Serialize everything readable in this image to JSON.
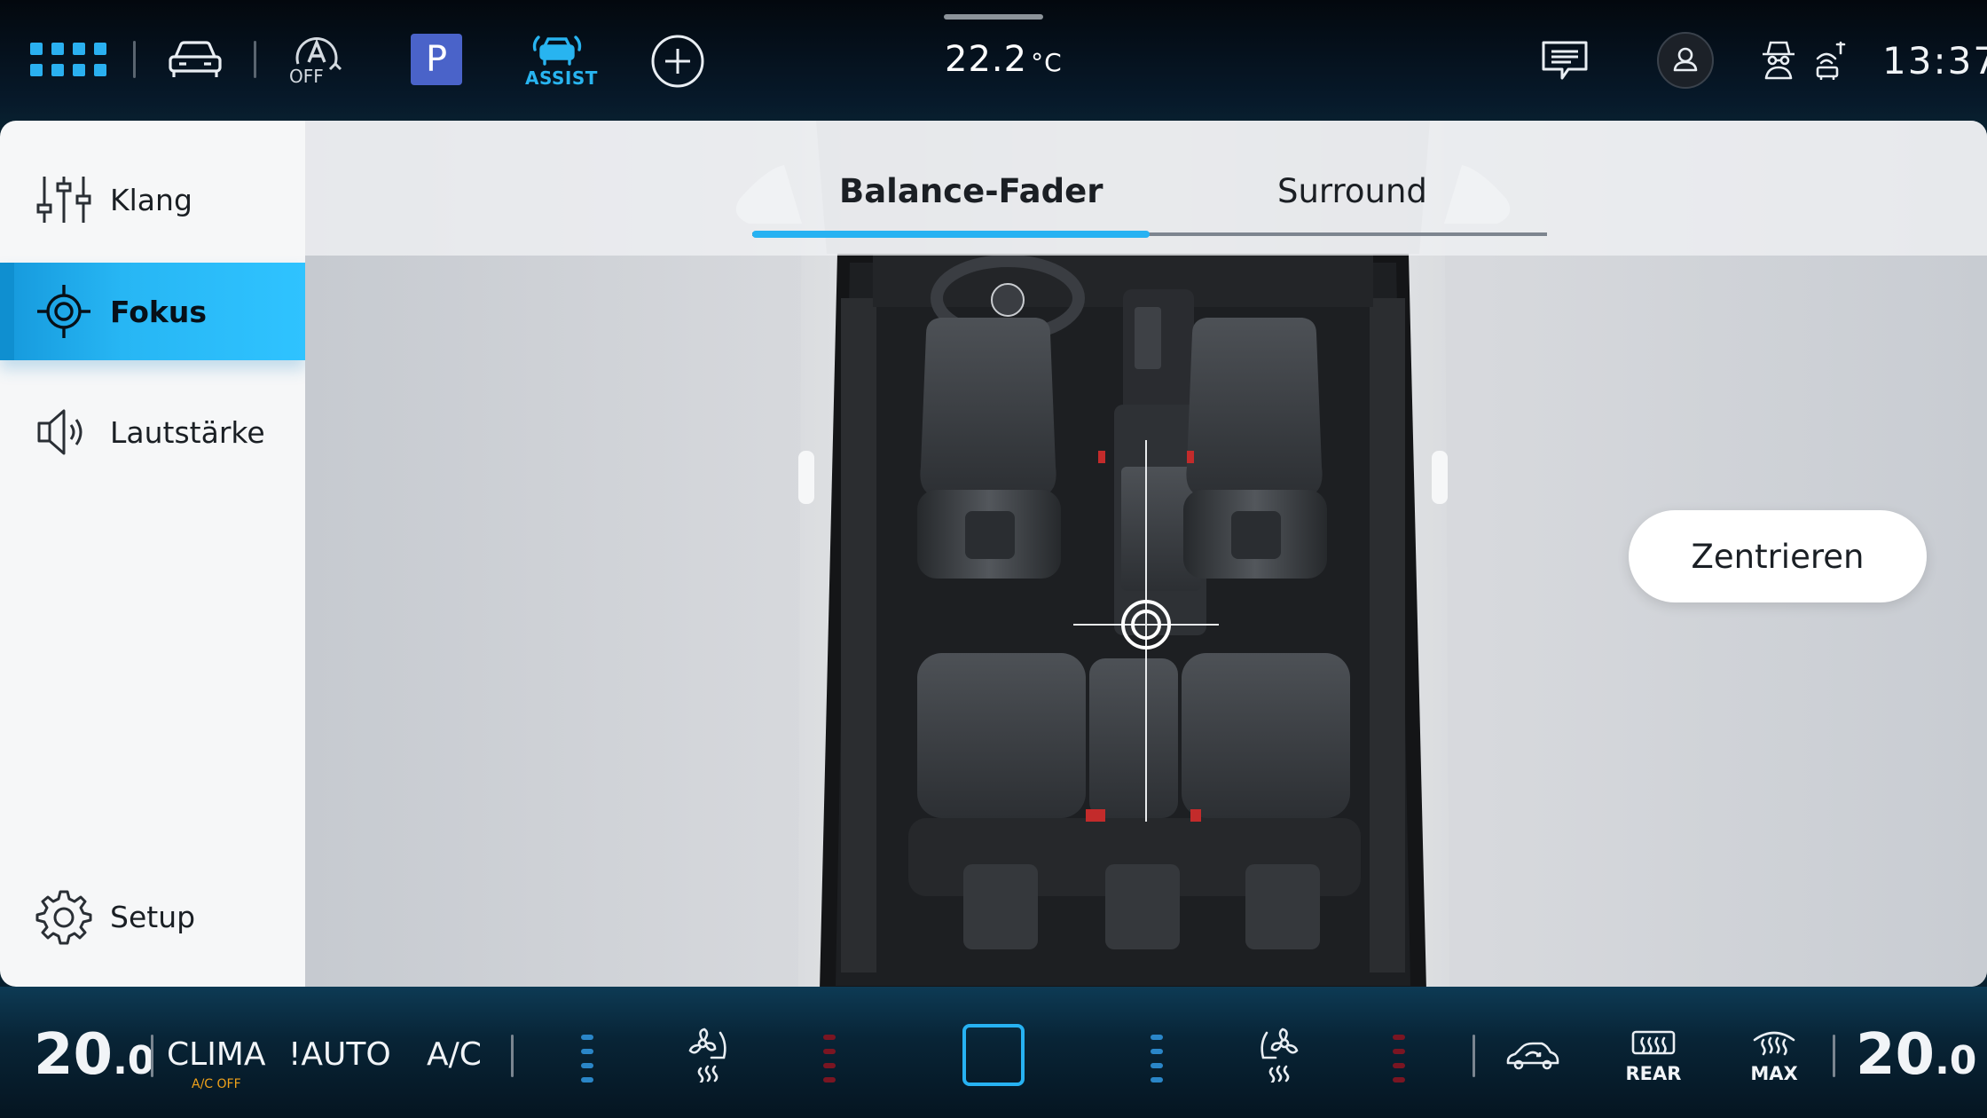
{
  "topbar": {
    "apps_icon": "apps-grid-icon",
    "car_icon": "car-front-icon",
    "auto_hold_label": "OFF",
    "parking_label": "P",
    "assist_label": "ASSIST",
    "add_icon": "plus-circle-icon",
    "outside_temp": "22.2",
    "outside_temp_unit": "°C",
    "messages_icon": "message-icon",
    "profile_icon": "user-profile-icon",
    "privacy_icon": "incognito-icon",
    "connectivity_icon": "car-wifi-icon",
    "time": "13:37"
  },
  "sidebar": {
    "items": [
      {
        "label": "Klang",
        "icon": "equalizer-icon",
        "active": false
      },
      {
        "label": "Fokus",
        "icon": "focus-target-icon",
        "active": true
      },
      {
        "label": "Lautstärke",
        "icon": "speaker-icon",
        "active": false
      },
      {
        "label": "Setup",
        "icon": "gear-icon",
        "active": false
      }
    ]
  },
  "main": {
    "tabs": [
      {
        "label": "Balance-Fader",
        "active": true
      },
      {
        "label": "Surround",
        "active": false
      }
    ],
    "center_button": "Zentrieren",
    "focus_marker_icon": "crosshair-icon"
  },
  "climate": {
    "left_temp_int": "20",
    "left_temp_dec": ".0",
    "clima_label": "CLIMA",
    "ac_off_label": "A/C OFF",
    "auto_label": "!AUTO",
    "ac_label": "A/C",
    "left_seat_icon": "seat-heat-fan-left-icon",
    "center_icon": "square-icon",
    "right_seat_icon": "seat-heat-fan-right-icon",
    "recirc_icon": "car-recirculation-icon",
    "rear_label": "REAR",
    "max_label": "MAX",
    "right_temp_int": "20",
    "right_temp_dec": ".0",
    "colors": {
      "blue": "#2a86c8",
      "red": "#7a1522",
      "accent": "#27b2f2",
      "amber": "#f0a21a"
    }
  }
}
